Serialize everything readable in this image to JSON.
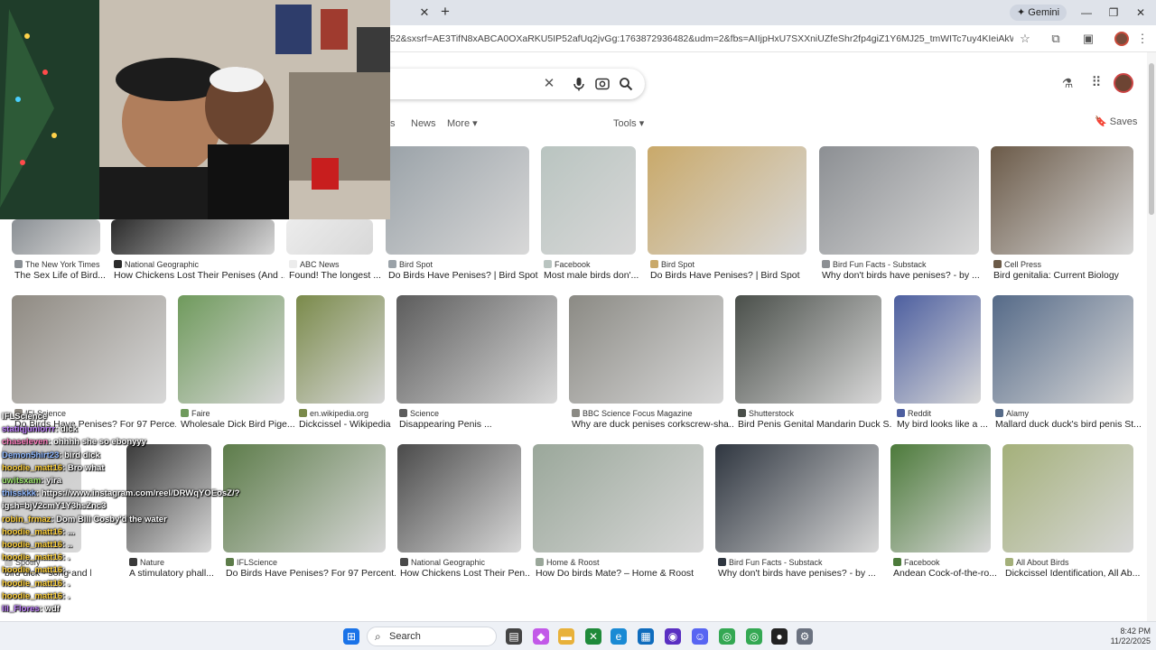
{
  "browser": {
    "gemini_label": "Gemini",
    "url": "52&sxsrf=AE3TifN8xABCA0OXaRKU5IP52afUq2jvGg:1763872936482&udm=2&fbs=AIIjpHxU7SXXniUZfeShr2fp4giZ1Y6MJ25_tmWITc7uy4KIeiAkWG4OIBE2zyCTMjPbG..."
  },
  "search": {
    "filters": [
      "s",
      "News",
      "More",
      "Tools"
    ],
    "saves_label": "Saves"
  },
  "results": [
    {
      "source": "The New York Times",
      "caption": "The Sex Life of Bird...",
      "color": "#8a8f94"
    },
    {
      "source": "National Geographic",
      "caption": "How Chickens Lost Their Penises (And ...",
      "color": "#2b2b2b"
    },
    {
      "source": "ABC News",
      "caption": "Found! The longest ...",
      "color": "#ececec"
    },
    {
      "source": "Bird Spot",
      "caption": "Do Birds Have Penises? | Bird Spot",
      "color": "#9aa2a8"
    },
    {
      "source": "Facebook",
      "caption": "Most male birds don'...",
      "color": "#b9c4c0"
    },
    {
      "source": "Bird Spot",
      "caption": "Do Birds Have Penises? | Bird Spot",
      "color": "#c9a96a"
    },
    {
      "source": "Bird Fun Facts - Substack",
      "caption": "Why don't birds have penises? - by ...",
      "color": "#8c8f93"
    },
    {
      "source": "Cell Press",
      "caption": "Bird genitalia: Current Biology",
      "color": "#6b5a48"
    },
    {
      "source": "IFLScience",
      "caption": "Do Birds Have Penises? For 97 Perce...",
      "color": "#8f8a82"
    },
    {
      "source": "Faire",
      "caption": "Wholesale Dick Bird Pige...",
      "color": "#6f9a5c"
    },
    {
      "source": "en.wikipedia.org",
      "caption": "Dickcissel - Wikipedia",
      "color": "#7a8a4a"
    },
    {
      "source": "Science",
      "caption": "Disappearing Penis ...",
      "color": "#5c5c5c"
    },
    {
      "source": "BBC Science Focus Magazine",
      "caption": "Why are duck penises corkscrew-sha...",
      "color": "#8b8a84"
    },
    {
      "source": "Shutterstock",
      "caption": "Bird Penis Genital Mandarin Duck S...",
      "color": "#4a4f4a"
    },
    {
      "source": "Reddit",
      "caption": "My bird looks like a ...",
      "color": "#4d5fa0"
    },
    {
      "source": "Alamy",
      "caption": "Mallard duck duck's bird penis St...",
      "color": "#556a88"
    },
    {
      "source": "Spotify",
      "caption": "bird dick - song and lyri...",
      "color": "#c8c8c8"
    },
    {
      "source": "Nature",
      "caption": "A stimulatory phall...",
      "color": "#3a3a3a"
    },
    {
      "source": "IFLScience",
      "caption": "Do Birds Have Penises? For 97 Percent...",
      "color": "#5d7c4a"
    },
    {
      "source": "National Geographic",
      "caption": "How Chickens Lost Their Pen...",
      "color": "#4a4a4a"
    },
    {
      "source": "Home & Roost",
      "caption": "How Do birds Mate? – Home & Roost",
      "color": "#9aa79a"
    },
    {
      "source": "Bird Fun Facts - Substack",
      "caption": "Why don't birds have penises? - by ...",
      "color": "#2f3640"
    },
    {
      "source": "Facebook",
      "caption": "Andean Cock-of-the-ro...",
      "color": "#4c7a3a"
    },
    {
      "source": "All About Birds",
      "caption": "Dickcissel Identification, All Ab...",
      "color": "#a4b07a"
    }
  ],
  "chat": [
    {
      "user": "IFLScience",
      "msg": "",
      "color": "#ffffff"
    },
    {
      "user": "statiqjuniorrr",
      "msg": ": dick",
      "color": "#c080ff"
    },
    {
      "user": "chaseleven",
      "msg": ": ohhhh she so ebonyyy",
      "color": "#ff7fbf"
    },
    {
      "user": "Demon5hirt23",
      "msg": ": bird dick",
      "color": "#8fb8ff"
    },
    {
      "user": "hoodie_matt16",
      "msg": ": Bro what",
      "color": "#ffd23f"
    },
    {
      "user": "uwitsxam",
      "msg": ": yira",
      "color": "#9fe870"
    },
    {
      "user": "thisskkk",
      "msg": ": https://www.instagram.com/reel/DRWqYOEosZ/?",
      "color": "#8fb8ff"
    },
    {
      "user": "igsh=bjV2cmY1Y3hsZnc3",
      "msg": "",
      "color": "#ffffff"
    },
    {
      "user": "robin_frmaz",
      "msg": ": Dom Bill Cosby'd the water",
      "color": "#ffd23f"
    },
    {
      "user": "hoodie_matt16",
      "msg": ": ...",
      "color": "#ffd23f"
    },
    {
      "user": "hoodie_matt16",
      "msg": ": ..",
      "color": "#ffd23f"
    },
    {
      "user": "hoodie_matt16",
      "msg": ": .",
      "color": "#ffd23f"
    },
    {
      "user": "hoodie_matt16",
      "msg": ": .",
      "color": "#ffd23f"
    },
    {
      "user": "hoodie_matt16",
      "msg": ": .",
      "color": "#ffd23f"
    },
    {
      "user": "hoodie_matt16",
      "msg": ": .",
      "color": "#ffd23f"
    },
    {
      "user": "lil_Flores",
      "msg": ": wdf",
      "color": "#c080ff"
    }
  ],
  "taskbar": {
    "search_label": "Search",
    "time": "8:42 PM",
    "date": "11/22/2025"
  }
}
